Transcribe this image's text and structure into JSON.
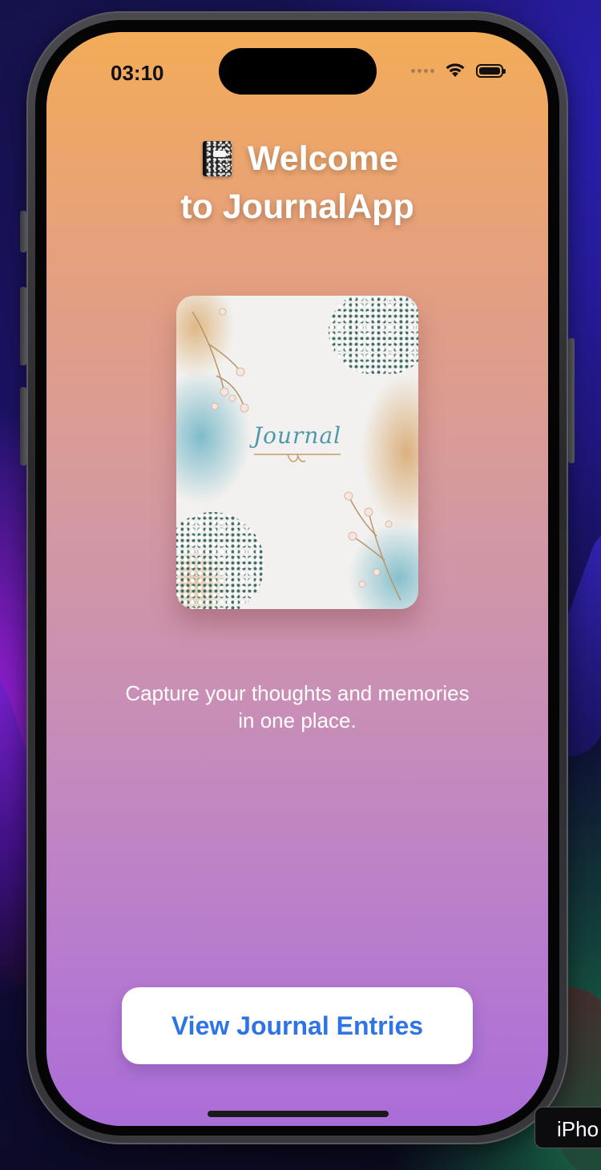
{
  "status_bar": {
    "time": "03:10"
  },
  "welcome": {
    "line1": "Welcome",
    "line2": "to JournalApp",
    "icon": "notebook-icon"
  },
  "cover": {
    "title": "Journal"
  },
  "tagline": {
    "line1": "Capture your thoughts and memories",
    "line2": "in one place."
  },
  "actions": {
    "view_entries_label": "View Journal Entries"
  },
  "device_label": "iPho",
  "colors": {
    "accent": "#2f74e6",
    "gradient_top": "#f3ac58",
    "gradient_bottom": "#aa6dd8"
  }
}
